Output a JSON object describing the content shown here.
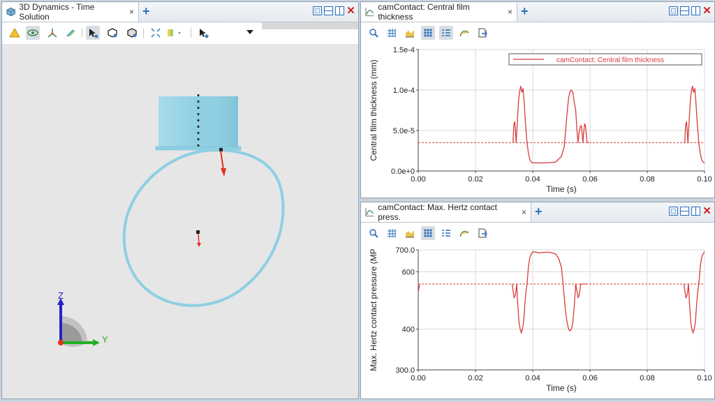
{
  "left_pane": {
    "tab_title": "3D Dynamics - Time Solution",
    "tab_close": "×",
    "add_tab": "+",
    "axis_labels": {
      "z": "Z",
      "y": "Y"
    }
  },
  "top_chart": {
    "tab_title": "camContact: Central film thickness",
    "tab_close": "×",
    "add_tab": "+"
  },
  "bottom_chart": {
    "tab_title": "camContact: Max. Hertz contact press.",
    "tab_close": "×",
    "add_tab": "+"
  },
  "colors": {
    "series": "#d93a3a",
    "cam": "#8ecfe3",
    "accent": "#2a6fbd"
  },
  "chart_data": [
    {
      "type": "line",
      "title": "",
      "xlabel": "Time (s)",
      "ylabel": "Central film thickness (mm)",
      "xlim": [
        0,
        0.1
      ],
      "ylim": [
        0,
        0.00015
      ],
      "xticks": [
        0,
        0.02,
        0.04,
        0.06,
        0.08,
        0.1
      ],
      "xtick_labels": [
        "0.00",
        "0.02",
        "0.04",
        "0.06",
        "0.08",
        "0.10"
      ],
      "yticks": [
        0,
        5e-05,
        0.0001,
        0.00015
      ],
      "ytick_labels": [
        "0.0e+0",
        "5.0e-5",
        "1.0e-4",
        "1.5e-4"
      ],
      "legend_position": "top-right",
      "grid": true,
      "reference": {
        "y": 3.5e-05,
        "style": "dashed"
      },
      "series": [
        {
          "name": "camContact: Central film thickness",
          "x": [
            0.0331,
            0.0334,
            0.0337,
            0.0339,
            0.0342,
            0.0346,
            0.035,
            0.0354,
            0.0358,
            0.0362,
            0.0366,
            0.037,
            0.0373,
            0.0376,
            0.038,
            0.0385,
            0.039,
            0.0395,
            0.04,
            0.041,
            0.042,
            0.045,
            0.048,
            0.05,
            0.051,
            0.0515,
            0.052,
            0.0525,
            0.053,
            0.0535,
            0.054,
            0.0545,
            0.055,
            0.0555,
            0.0558,
            0.0562,
            0.0566,
            0.0569,
            0.0572,
            0.0575,
            0.0578,
            0.0581,
            0.0584,
            0.0587,
            0.059,
            0.0593,
            0.0596
          ],
          "y": [
            3.5e-05,
            5.7e-05,
            6.1e-05,
            5.2e-05,
            3.5e-05,
            6e-05,
            8.5e-05,
            9.8e-05,
            0.000105,
            9.7e-05,
            0.000102,
            8.5e-05,
            6.8e-05,
            5.2e-05,
            3.5e-05,
            2.2e-05,
            1.4e-05,
            1.1e-05,
            1e-05,
            1e-05,
            1e-05,
            1e-05,
            1.1e-05,
            1.8e-05,
            3e-05,
            5e-05,
            7.2e-05,
            9e-05,
            9.8e-05,
            0.0001,
            9.7e-05,
            8.5e-05,
            7.5e-05,
            4.8e-05,
            3.5e-05,
            4.8e-05,
            5.5e-05,
            5.6e-05,
            4.8e-05,
            3.5e-05,
            4.8e-05,
            5.8e-05,
            5.7e-05,
            4.5e-05,
            3.5e-05,
            3.5e-05,
            3.5e-05
          ]
        }
      ]
    },
    {
      "type": "line",
      "title": "",
      "xlabel": "Time (s)",
      "ylabel": "Max. Hertz contact pressure (MP",
      "xlim": [
        0,
        0.1
      ],
      "ylim": [
        300,
        700
      ],
      "scale": "log",
      "xticks": [
        0,
        0.02,
        0.04,
        0.06,
        0.08,
        0.1
      ],
      "xtick_labels": [
        "0.00",
        "0.02",
        "0.04",
        "0.06",
        "0.08",
        "0.10"
      ],
      "yticks": [
        300,
        400,
        600,
        700
      ],
      "ytick_labels": [
        "300.0",
        "400",
        "600",
        "700.0"
      ],
      "grid": true,
      "reference": {
        "y": 550,
        "style": "dashed"
      },
      "series": [
        {
          "name": "",
          "x": [
            0.0328,
            0.0332,
            0.0335,
            0.0338,
            0.0341,
            0.0344,
            0.0348,
            0.0352,
            0.0356,
            0.036,
            0.0364,
            0.0368,
            0.0372,
            0.0376,
            0.038,
            0.0385,
            0.039,
            0.0395,
            0.04,
            0.041,
            0.042,
            0.044,
            0.046,
            0.048,
            0.049,
            0.05,
            0.0505,
            0.051,
            0.0515,
            0.052,
            0.0525,
            0.053,
            0.0535,
            0.054,
            0.0545,
            0.055,
            0.0555,
            0.0558,
            0.0561,
            0.0564,
            0.0567,
            0.057,
            0.0573,
            0.0576,
            0.058,
            0.0584,
            0.0587,
            0.059
          ],
          "y": [
            550,
            520,
            500,
            505,
            520,
            550,
            470,
            420,
            400,
            390,
            400,
            420,
            470,
            520,
            550,
            620,
            665,
            680,
            690,
            690,
            685,
            688,
            688,
            680,
            660,
            620,
            560,
            500,
            450,
            420,
            400,
            395,
            400,
            420,
            470,
            550,
            520,
            500,
            505,
            520,
            550,
            550,
            550,
            550,
            550,
            550,
            550,
            550
          ]
        }
      ]
    }
  ]
}
